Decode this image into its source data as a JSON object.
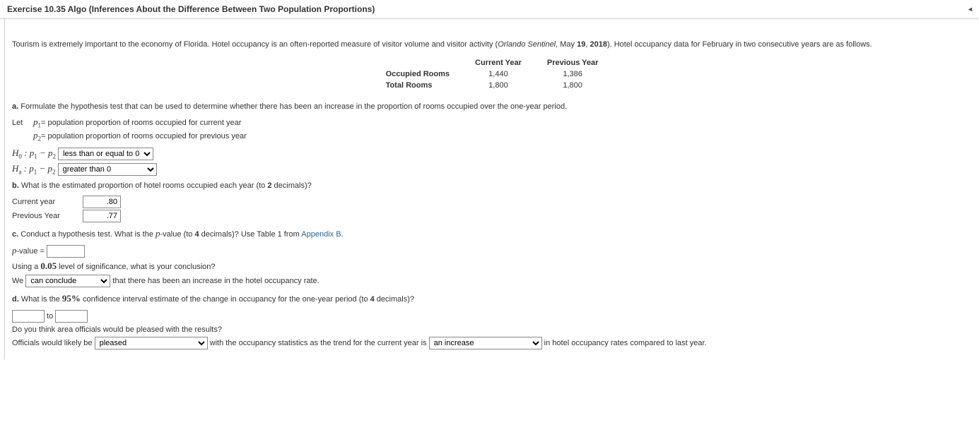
{
  "header": {
    "title": "Exercise 10.35 Algo (Inferences About the Difference Between Two Population Proportions)"
  },
  "intro": {
    "text_before_citation": "Tourism is extremely important to the economy of Florida. Hotel occupancy is an often-reported measure of visitor volume and visitor activity (",
    "citation_source": "Orlando Sentinel",
    "citation_sep": ", May ",
    "citation_day": "19",
    "citation_sep2": ", ",
    "citation_year": "2018",
    "text_after_citation": "). Hotel occupancy data for February in two consecutive years are as follows."
  },
  "table": {
    "col_current": "Current Year",
    "col_previous": "Previous Year",
    "row_occupied": "Occupied Rooms",
    "row_total": "Total Rooms",
    "occ_current": "1,440",
    "occ_previous": "1,386",
    "total_current": "1,800",
    "total_previous": "1,800"
  },
  "a": {
    "prefix": "a.",
    "text": " Formulate the hypothesis test that can be used to determine whether there has been an increase in the proportion of rooms occupied over the one-year period.",
    "let": "Let",
    "p1_def": " = population proportion of rooms occupied for current year",
    "p2_def": " = population proportion of rooms occupied for previous year",
    "h0_select": "less than or equal to 0",
    "ha_select": "greater than 0"
  },
  "b": {
    "prefix": "b.",
    "text_before": " What is the estimated proportion of hotel rooms occupied each year (to ",
    "decimals": "2",
    "text_after": " decimals)?",
    "current_label": "Current year",
    "previous_label": "Previous Year",
    "current_value": ".80",
    "previous_value": ".77"
  },
  "c": {
    "prefix": "c.",
    "text_before": " Conduct a hypothesis test. What is the ",
    "pword": "p",
    "text_mid": "-value (to ",
    "decimals": "4",
    "text_after": " decimals)? Use Table 1 from ",
    "link": "Appendix B",
    "period": ".",
    "pvalue_label": "-value = ",
    "pvalue_value": "",
    "sig_before": "Using a ",
    "sig_level": "0.05",
    "sig_after": " level of significance, what is your conclusion?",
    "we": "We ",
    "conclude_select": "can conclude",
    "conclude_after": " that there has been an increase in the hotel occupancy rate."
  },
  "d": {
    "prefix": "d.",
    "text_before": " What is the ",
    "pct": "95%",
    "text_mid": " confidence interval estimate of the change in occupancy for the one-year period (to ",
    "decimals": "4",
    "text_after": " decimals)?",
    "ci_lower": "",
    "ci_to": " to ",
    "ci_upper": "",
    "pleased_q": "Do you think area officials would be pleased with the results?",
    "officials_before": "Officials would likely be ",
    "pleased_select": "pleased",
    "officials_mid": " with the occupancy statistics as the trend for the current year is ",
    "trend_select": "an increase",
    "officials_after": " in hotel occupancy rates compared to last year."
  }
}
